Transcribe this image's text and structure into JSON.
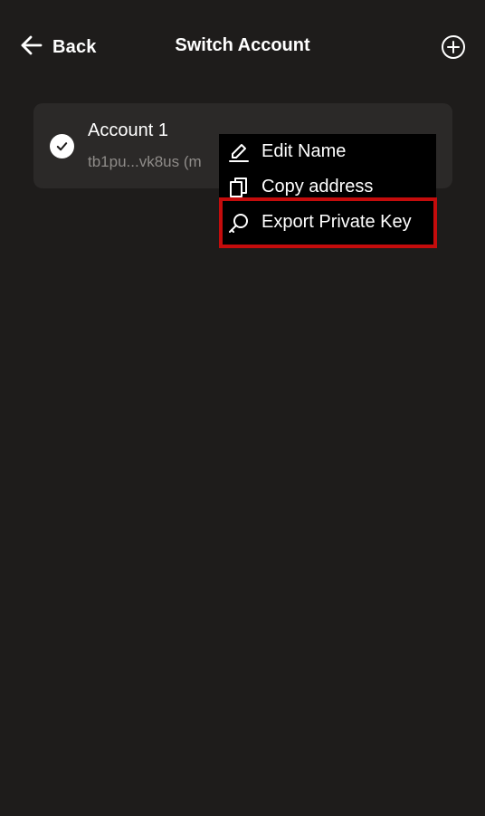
{
  "header": {
    "back_label": "Back",
    "title": "Switch Account",
    "back_icon": "arrow-left-icon",
    "add_icon": "plus-circle-icon"
  },
  "account": {
    "name": "Account 1",
    "address": "tb1pu...vk8us (m",
    "selected_icon": "check-circle-icon"
  },
  "context_menu": {
    "items": [
      {
        "label": "Edit Name",
        "icon": "pencil-icon"
      },
      {
        "label": "Copy address",
        "icon": "copy-icon"
      },
      {
        "label": "Export Private Key",
        "icon": "key-icon"
      }
    ]
  },
  "colors": {
    "background": "#1e1c1b",
    "card": "#2b2928",
    "menu": "#000000",
    "secondary_text": "#8f8c89",
    "highlight": "#c40c0c"
  }
}
